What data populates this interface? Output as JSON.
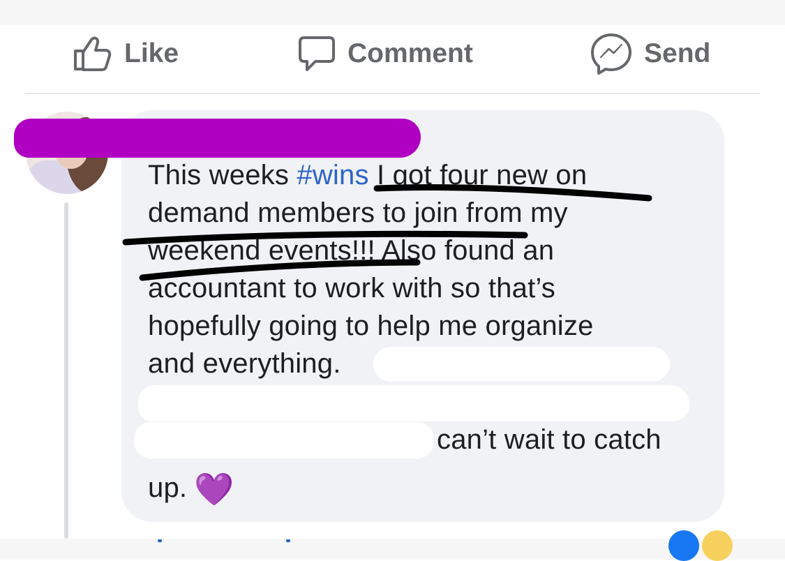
{
  "actions": {
    "like_label": "Like",
    "comment_label": "Comment",
    "send_label": "Send"
  },
  "comment": {
    "author_name": "",
    "lines": [
      {
        "before": "This weeks ",
        "hashtag": "#wins",
        "after": " I got four new on"
      },
      {
        "text": "demand members to join from my"
      },
      {
        "text": "weekend events!!! Also found an"
      },
      {
        "text": "accountant to work with so that’s"
      },
      {
        "text": "hopefully going to help me organize"
      },
      {
        "text": "and everything."
      },
      {
        "text": "can’t wait to catch"
      },
      {
        "text": "up."
      }
    ],
    "emoji": "💜"
  },
  "icons": [
    "like-thumb-icon",
    "comment-bubble-icon",
    "messenger-send-icon",
    "purple-heart-emoji"
  ],
  "colors": {
    "bubble_bg": "#f0f2f5",
    "action_text": "#65676b",
    "hashtag": "#2d63c8",
    "redaction_magenta": "#b000c2"
  }
}
